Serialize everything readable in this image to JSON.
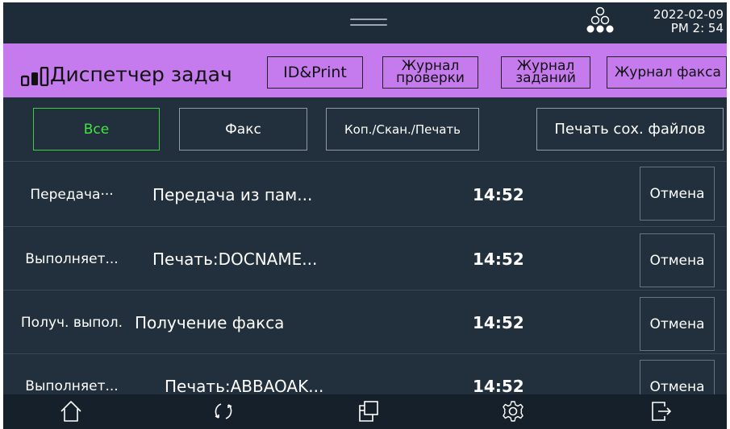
{
  "status_bar": {
    "date": "2022-02-09",
    "time": "PM 2: 54",
    "network_icon": "network-tree-icon"
  },
  "header": {
    "title": "Диспетчер задач",
    "app_icon": "bar-signal-icon",
    "buttons": [
      {
        "label": "ID&Print"
      },
      {
        "line1": "Журнал",
        "line2": "проверки"
      },
      {
        "line1": "Журнал",
        "line2": "заданий"
      },
      {
        "label": "Журнал факса"
      }
    ]
  },
  "filters": {
    "all": "Все",
    "fax": "Факс",
    "copy_scan_print": "Коп./Скан./Печать",
    "print_saved": "Печать сох. файлов",
    "active": "all"
  },
  "jobs": [
    {
      "status": "Передача···",
      "name": "Передача из пам...",
      "time": "14:52",
      "cancel": "Отмена"
    },
    {
      "status": "Выполняет...",
      "name": "Печать:DOCNAME...",
      "time": "14:52",
      "cancel": "Отмена"
    },
    {
      "status": "Получ. выпол.",
      "name": "Получение факса",
      "time": "14:52",
      "cancel": "Отмена"
    },
    {
      "status": "Выполняет...",
      "name": "Печать:ABBAOAK...",
      "time": "14:52",
      "cancel": "Отмена"
    }
  ],
  "nav": [
    "home-icon",
    "refresh-icon",
    "copy-windows-icon",
    "settings-gear-icon",
    "exit-icon"
  ],
  "colors": {
    "background": "#22303d",
    "header": "#c57bee",
    "active_filter": "#45e245",
    "navbar": "#16202a"
  }
}
